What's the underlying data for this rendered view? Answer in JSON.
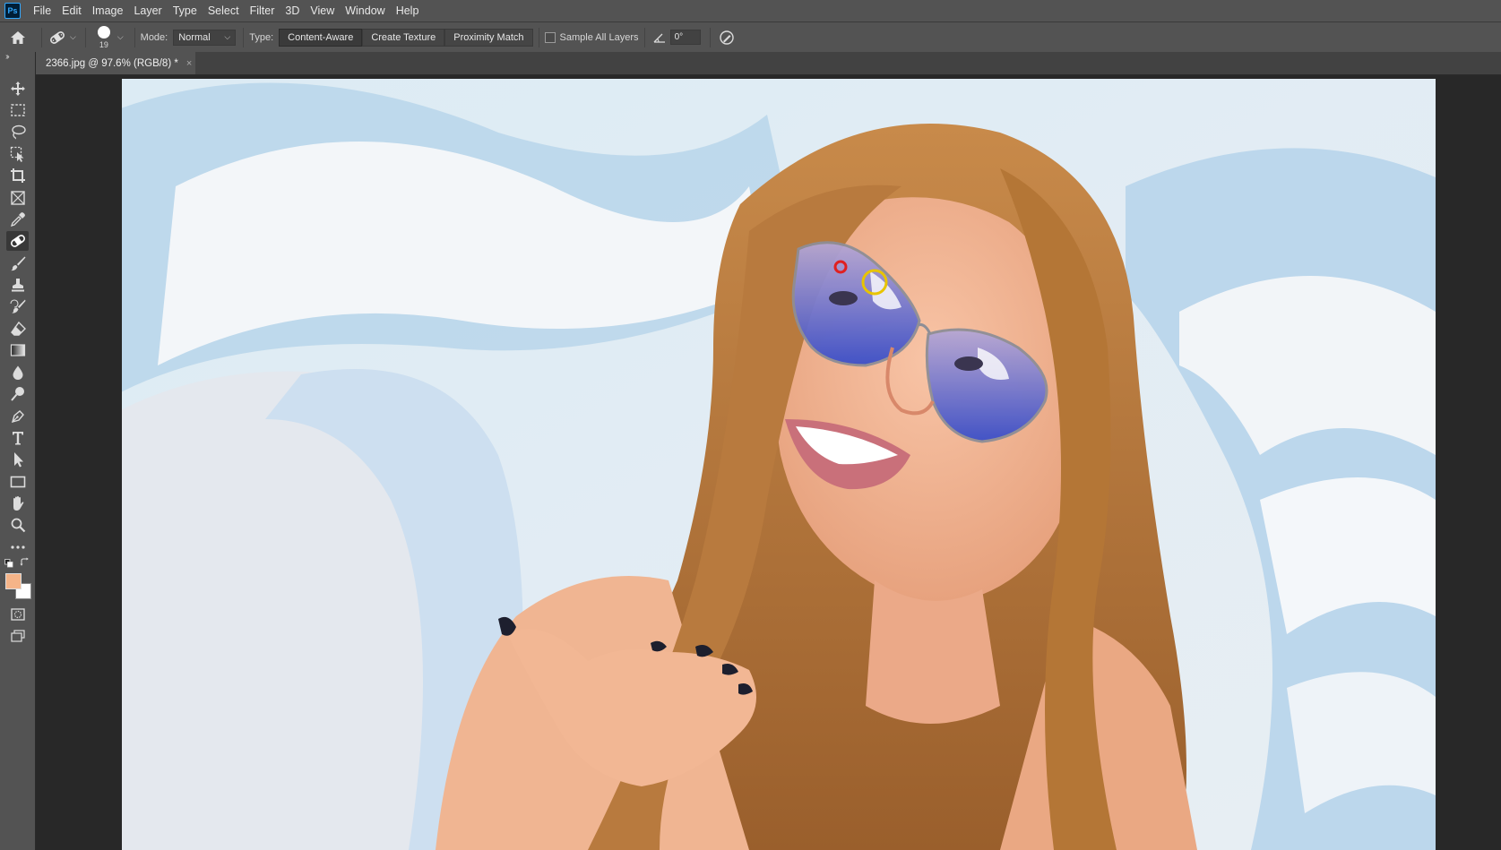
{
  "app": {
    "logo": "Ps"
  },
  "menu": [
    "File",
    "Edit",
    "Image",
    "Layer",
    "Type",
    "Select",
    "Filter",
    "3D",
    "View",
    "Window",
    "Help"
  ],
  "options": {
    "brush_size": "19",
    "mode_label": "Mode:",
    "mode_value": "Normal",
    "type_label": "Type:",
    "type_buttons": [
      "Content-Aware",
      "Create Texture",
      "Proximity Match"
    ],
    "active_type": "Content-Aware",
    "sample_all_layers": "Sample All Layers",
    "sample_all_layers_checked": false,
    "angle_value": "0°"
  },
  "document": {
    "tab_title": "2366.jpg @ 97.6% (RGB/8) *",
    "close_glyph": "×"
  },
  "tools": [
    {
      "name": "move-tool-icon"
    },
    {
      "name": "rectangular-marquee-tool-icon"
    },
    {
      "name": "lasso-tool-icon"
    },
    {
      "name": "object-selection-tool-icon"
    },
    {
      "name": "crop-tool-icon"
    },
    {
      "name": "frame-tool-icon"
    },
    {
      "name": "eyedropper-tool-icon"
    },
    {
      "name": "spot-healing-brush-tool-icon",
      "active": true
    },
    {
      "name": "brush-tool-icon"
    },
    {
      "name": "clone-stamp-tool-icon"
    },
    {
      "name": "history-brush-tool-icon"
    },
    {
      "name": "eraser-tool-icon"
    },
    {
      "name": "gradient-tool-icon"
    },
    {
      "name": "blur-tool-icon"
    },
    {
      "name": "dodge-tool-icon"
    },
    {
      "name": "pen-tool-icon"
    },
    {
      "name": "type-tool-icon"
    },
    {
      "name": "path-selection-tool-icon"
    },
    {
      "name": "rectangle-tool-icon"
    },
    {
      "name": "hand-tool-icon"
    },
    {
      "name": "zoom-tool-icon"
    },
    {
      "name": "edit-toolbar-icon"
    }
  ],
  "colors": {
    "foreground": "#f5b488",
    "background": "#ffffff",
    "marker_red": "#e02020",
    "marker_yellow": "#e8c400"
  }
}
